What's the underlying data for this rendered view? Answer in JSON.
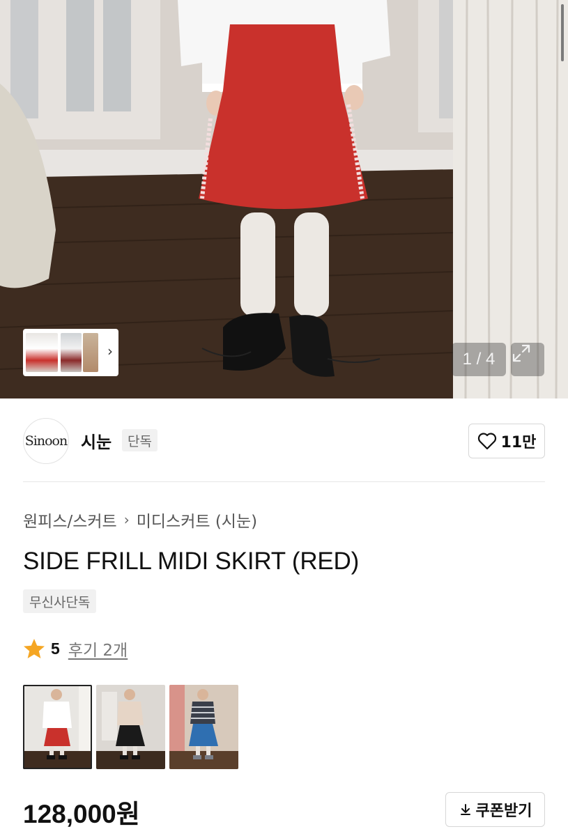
{
  "gallery": {
    "counter": "1 / 4",
    "expand_icon": "expand-icon",
    "thumb_strip_icon": "chevron-right-icon"
  },
  "brand": {
    "logo_text": "Sinoon",
    "name": "시눈",
    "badge": "단독",
    "like_icon": "heart-icon",
    "like_count": "11만"
  },
  "product": {
    "breadcrumb": [
      "원피스/스커트",
      "미디스커트 (시눈)"
    ],
    "breadcrumb_separator_icon": "chevron-right-icon",
    "title": "SIDE FRILL MIDI SKIRT (RED)",
    "exclusive_badge": "무신사단독",
    "rating": {
      "star_icon": "star-icon",
      "score": "5",
      "reviews_label": "후기 2개"
    },
    "color_options": [
      {
        "selected": true,
        "skirt_color": "#c9312c"
      },
      {
        "selected": false,
        "skirt_color": "#1a1a1a"
      },
      {
        "selected": false,
        "skirt_color": "#2f6fb1"
      }
    ],
    "price": "128,000원",
    "coupon_label": "쿠폰받기",
    "coupon_icon": "download-icon"
  },
  "colors": {
    "star": "#f5a623",
    "text": "#111111",
    "muted": "#777777",
    "badge_bg": "#f1f1f1"
  }
}
